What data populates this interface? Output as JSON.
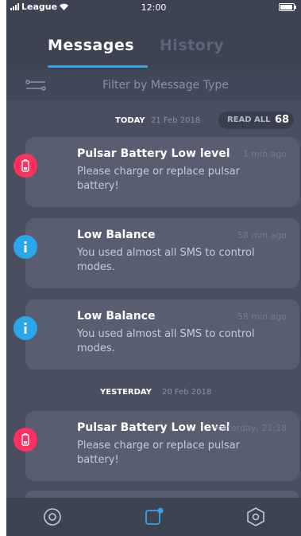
{
  "status_bar": {
    "carrier": "League",
    "time": "12:00"
  },
  "tabs": [
    {
      "label": "Messages",
      "active": true
    },
    {
      "label": "History",
      "active": false
    }
  ],
  "filter": {
    "label": "Filter by Message Type"
  },
  "sections": {
    "today": {
      "label": "TODAY",
      "date": "21 Feb 2018"
    },
    "yesterday": {
      "label": "YESTERDAY",
      "date": "20 Feb 2018"
    }
  },
  "read_all": {
    "label": "READ ALL",
    "count": "68"
  },
  "messages": [
    {
      "title": "Pulsar Battery Low level",
      "time": "1 min ago",
      "body_line1": "Please charge or replace pulsar",
      "body_line2": "battery!",
      "icon": "battery-icon",
      "color": "#ff2f5e"
    },
    {
      "title": "Low Balance",
      "time": "58 min ago",
      "body_line1": "You used almost all SMS to control",
      "body_line2": "modes.",
      "icon": "info-icon",
      "color": "#2aa6ec"
    },
    {
      "title": "Low Balance",
      "time": "58 min ago",
      "body_line1": "You used almost all SMS to control",
      "body_line2": "modes.",
      "icon": "info-icon",
      "color": "#2aa6ec"
    },
    {
      "title": "Pulsar Battery Low level",
      "time": "Yesterday, 21:18",
      "body_line1": "Please charge or replace pulsar",
      "body_line2": "battery!",
      "icon": "battery-icon",
      "color": "#ff2f5e"
    }
  ],
  "bottom_nav": [
    {
      "icon": "target-icon",
      "active": false
    },
    {
      "icon": "messages-icon",
      "active": true
    },
    {
      "icon": "hexagon-settings-icon",
      "active": false
    }
  ],
  "colors": {
    "background": "#4a4f5f",
    "header": "#3e4352",
    "card": "#585e70",
    "accent": "#3aa2e8",
    "alert": "#ff2f5e",
    "info": "#2aa6ec"
  }
}
